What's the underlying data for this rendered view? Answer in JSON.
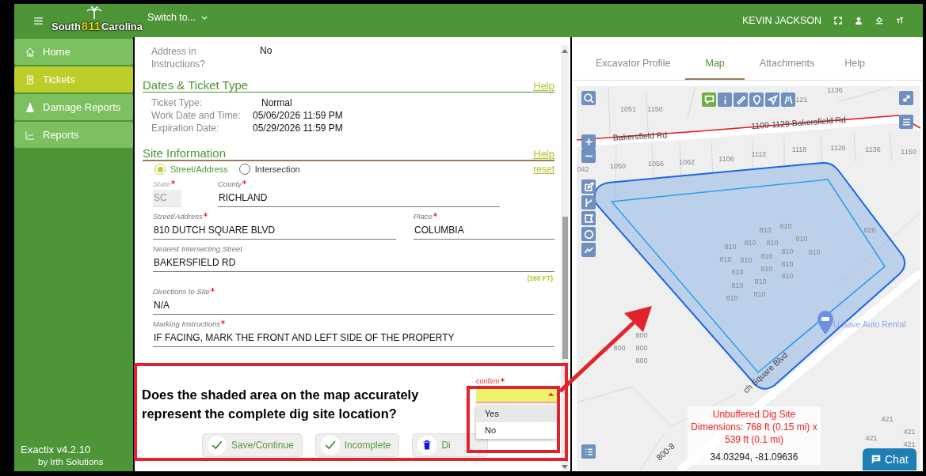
{
  "header": {
    "logo": {
      "left": "South",
      "number": "811",
      "right": "Carolina"
    },
    "switch_label": "Switch to...",
    "user": "KEVIN JACKSON"
  },
  "sidebar": {
    "items": [
      {
        "label": "Home",
        "selected": false
      },
      {
        "label": "Tickets",
        "selected": true
      },
      {
        "label": "Damage Reports",
        "selected": false
      },
      {
        "label": "Reports",
        "selected": false
      }
    ],
    "version": "Exactix v4.2.10",
    "vendor": "by Irth Solutions"
  },
  "details": [
    {
      "label": "Address in Instructions?",
      "value": "No"
    }
  ],
  "dates_section": {
    "title": "Dates & Ticket Type",
    "help": "Help",
    "rows": [
      {
        "label": "Ticket Type:",
        "value": "Normal"
      },
      {
        "label": "Work Date and Time:",
        "value": "05/06/2026 11:59 PM"
      },
      {
        "label": "Expiration Date:",
        "value": "05/29/2026 11:59 PM"
      }
    ]
  },
  "site_section": {
    "title": "Site Information",
    "help": "Help",
    "reset": "reset",
    "location_types": [
      {
        "label": "Street/Address",
        "selected": true
      },
      {
        "label": "Intersection",
        "selected": false
      }
    ],
    "field_rows": [
      [
        {
          "label": "State",
          "required": true,
          "value": "SC",
          "disabled": true
        },
        {
          "label": "County",
          "required": true,
          "value": "RICHLAND",
          "disabled": false
        }
      ],
      [
        {
          "label": "Street/Address",
          "required": true,
          "value": "810 DUTCH SQUARE BLVD",
          "disabled": false
        },
        {
          "label": "Place",
          "required": true,
          "value": "COLUMBIA",
          "disabled": false
        }
      ],
      [
        {
          "label": "Nearest Intersecting Street",
          "required": false,
          "value": "BAKERSFIELD RD",
          "disabled": false,
          "hint": "(165 FT)"
        }
      ],
      [
        {
          "label": "Directions to Site",
          "required": true,
          "value": "N/A",
          "disabled": false
        }
      ],
      [
        {
          "label": "Marking Instructions",
          "required": true,
          "value": "IF FACING, MARK THE FRONT AND LEFT SIDE OF THE PROPERTY",
          "disabled": false
        }
      ]
    ]
  },
  "question": {
    "text": "Does the shaded area on the map accurately represent the complete dig site location?",
    "confirm": {
      "label": "confirm",
      "required": true,
      "options": [
        {
          "label": "Yes",
          "selected": true
        },
        {
          "label": "No",
          "selected": false
        }
      ]
    },
    "buttons": [
      {
        "label": "Save/Continue"
      },
      {
        "label": "Incomplete"
      },
      {
        "label": "Di"
      }
    ]
  },
  "tabs": [
    {
      "label": "Excavator Profile",
      "selected": false
    },
    {
      "label": "Map",
      "selected": true
    },
    {
      "label": "Attachments",
      "selected": false
    },
    {
      "label": "Help",
      "selected": false
    }
  ],
  "map": {
    "labels": [
      {
        "text": "1051",
        "kind": "lot"
      },
      {
        "text": "1150",
        "kind": "lot"
      },
      {
        "text": "121",
        "kind": "lot"
      },
      {
        "text": "1136",
        "kind": "lot"
      },
      {
        "text": "042",
        "kind": "lot"
      },
      {
        "text": "1050",
        "kind": "lot"
      },
      {
        "text": "1056",
        "kind": "lot"
      },
      {
        "text": "1062",
        "kind": "lot"
      },
      {
        "text": "1106",
        "kind": "lot"
      },
      {
        "text": "1112",
        "kind": "lot"
      },
      {
        "text": "1118",
        "kind": "lot"
      },
      {
        "text": "1126",
        "kind": "lot"
      },
      {
        "text": "1136",
        "kind": "lot"
      },
      {
        "text": "1150",
        "kind": "lot"
      },
      {
        "text": "828",
        "kind": "lot"
      },
      {
        "text": "810",
        "kind": "lot"
      },
      {
        "text": "810",
        "kind": "lot"
      },
      {
        "text": "810",
        "kind": "lot"
      },
      {
        "text": "810",
        "kind": "lot"
      },
      {
        "text": "810",
        "kind": "lot"
      },
      {
        "text": "810",
        "kind": "lot"
      },
      {
        "text": "810",
        "kind": "lot"
      },
      {
        "text": "810",
        "kind": "lot"
      },
      {
        "text": "810",
        "kind": "lot"
      },
      {
        "text": "810",
        "kind": "lot"
      },
      {
        "text": "810",
        "kind": "lot"
      },
      {
        "text": "810",
        "kind": "lot"
      },
      {
        "text": "810",
        "kind": "lot"
      },
      {
        "text": "810",
        "kind": "lot"
      },
      {
        "text": "810",
        "kind": "lot"
      },
      {
        "text": "810",
        "kind": "lot"
      },
      {
        "text": "810",
        "kind": "lot"
      },
      {
        "text": "810",
        "kind": "lot"
      },
      {
        "text": "810",
        "kind": "lot"
      },
      {
        "text": "800",
        "kind": "lot"
      },
      {
        "text": "800",
        "kind": "lot"
      },
      {
        "text": "800",
        "kind": "lot"
      },
      {
        "text": "800",
        "kind": "lot"
      },
      {
        "text": "421",
        "kind": "lot"
      },
      {
        "text": "421",
        "kind": "lot"
      },
      {
        "text": "421",
        "kind": "lot"
      },
      {
        "text": "421",
        "kind": "lot"
      },
      {
        "text": "Bakersfield Rd",
        "kind": "street"
      },
      {
        "text": "1100-1129 Bakersfield Rd",
        "kind": "street"
      },
      {
        "text": "ch Square Blvd",
        "kind": "street"
      },
      {
        "text": "800-8",
        "kind": "street"
      },
      {
        "text": "U Save Auto Rental",
        "kind": "place"
      }
    ],
    "info": {
      "title": "Unbuffered Dig Site",
      "dimensions": "Dimensions: 768 ft (0.15 mi) x 539 ft (0.1 mi)"
    },
    "coordinates": "34.03294, -81.09636",
    "chat": "Chat"
  }
}
